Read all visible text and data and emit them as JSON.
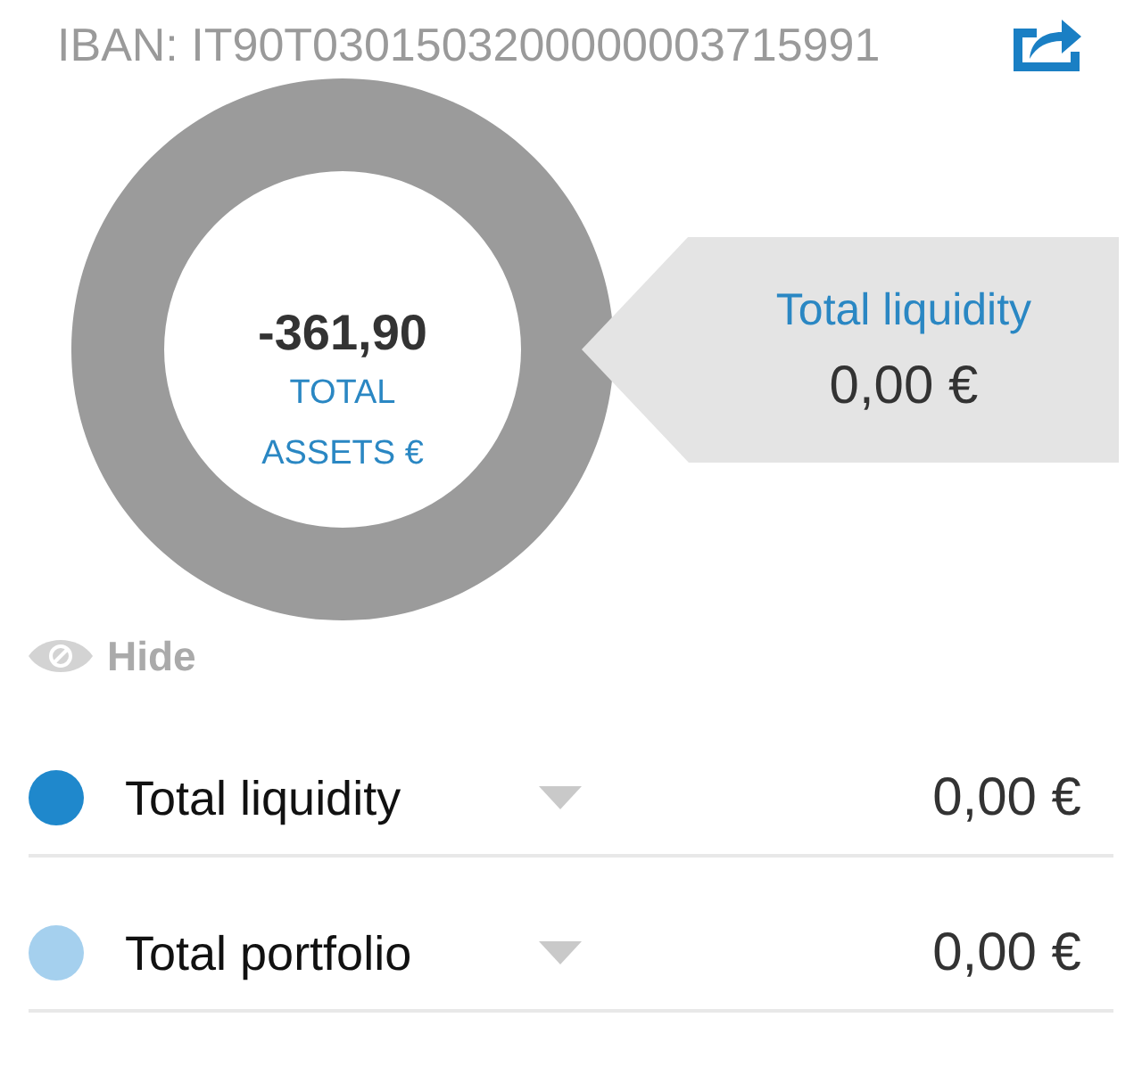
{
  "account": {
    "iban": "IBAN: IT90T0301503200000003715991"
  },
  "summary": {
    "total": "-361,90",
    "label": "TOTAL ASSETS €"
  },
  "callout": {
    "title": "Total liquidity",
    "value": "0,00 €"
  },
  "hide_toggle": {
    "label": "Hide"
  },
  "categories": [
    {
      "name": "Total liquidity",
      "value": "0,00 €",
      "color": "#1f88cc"
    },
    {
      "name": "Total portfolio",
      "value": "0,00 €",
      "color": "#a5d0ee"
    }
  ]
}
